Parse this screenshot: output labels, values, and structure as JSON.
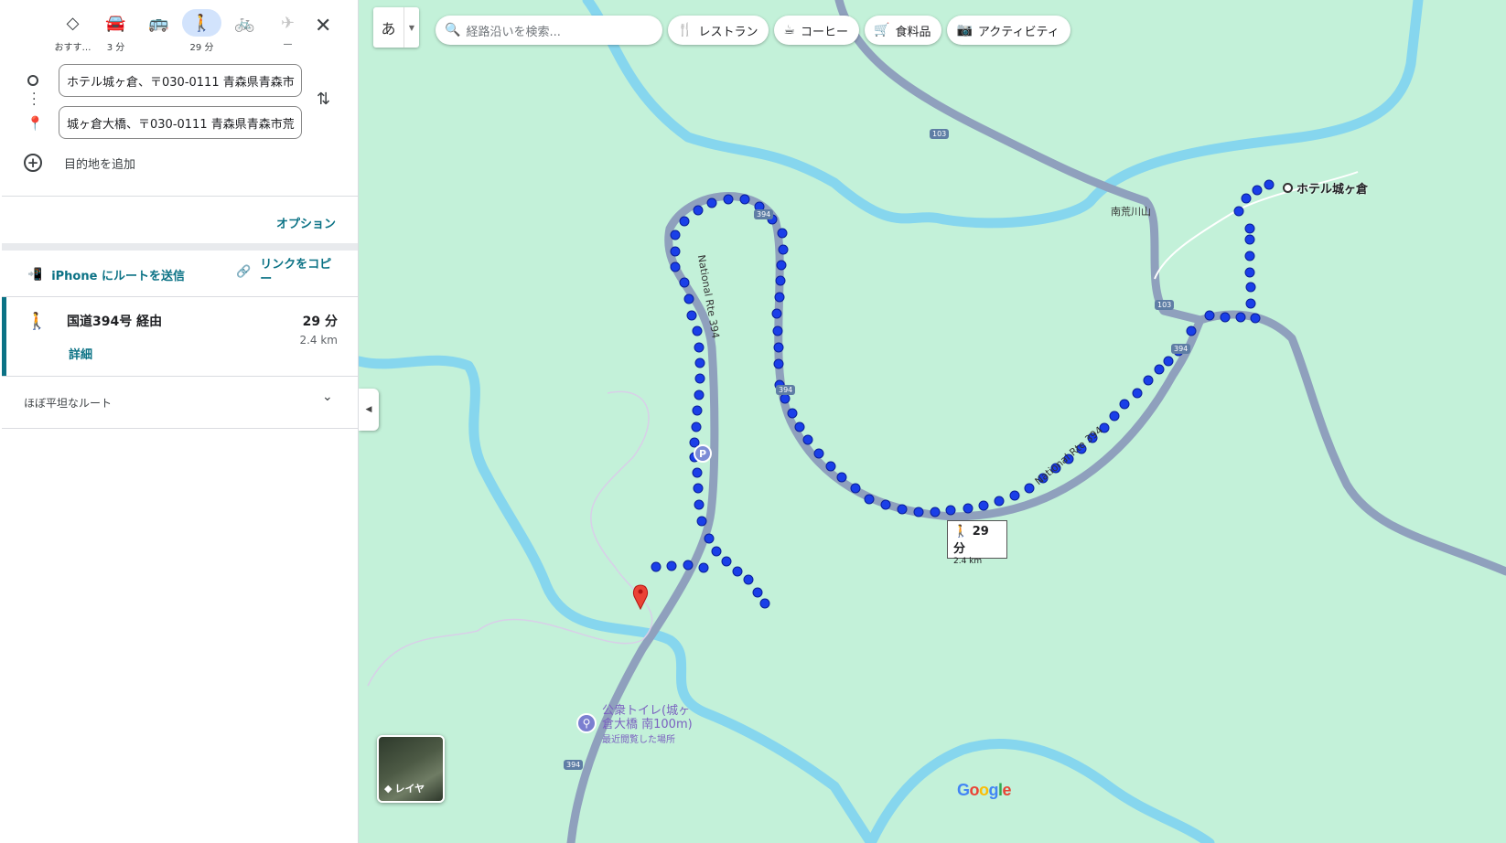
{
  "panel": {
    "modes": [
      {
        "name": "best",
        "icon": "diamond-route-icon",
        "glyph": "◇",
        "label": "おすす…"
      },
      {
        "name": "drive",
        "icon": "car-icon",
        "glyph": "🚘",
        "label": "3 分"
      },
      {
        "name": "transit",
        "icon": "bus-icon",
        "glyph": "🚌",
        "label": ""
      },
      {
        "name": "walk",
        "icon": "walking-icon",
        "glyph": "🚶",
        "label": "29 分"
      },
      {
        "name": "bike",
        "icon": "bicycle-icon",
        "glyph": "🚲",
        "label": ""
      },
      {
        "name": "flight",
        "icon": "airplane-icon",
        "glyph": "✈",
        "label": "—"
      }
    ],
    "origin_value": "ホテル城ヶ倉、〒030-0111 青森県青森市",
    "destination_value": "城ヶ倉大橋、〒030-0111 青森県青森市荒",
    "add_destination": "目的地を追加",
    "options": "オプション",
    "send_to_phone": "iPhone にルートを送信",
    "copy_link": "リンクをコピー",
    "route": {
      "via": "国道394号 経由",
      "details": "詳細",
      "duration": "29 分",
      "distance": "2.4 km"
    },
    "terrain_note": "ほぼ平坦なルート"
  },
  "map": {
    "ime_char": "あ",
    "search_placeholder": "経路沿いを検索...",
    "chips": [
      "レストラン",
      "コーヒー",
      "食料品",
      "アクティビティ"
    ],
    "time_label": {
      "duration": "29 分",
      "distance": "2.4 km"
    },
    "origin_label": "ホテル城ヶ倉",
    "place_minamiarakawa": "南荒川山",
    "road_labels": {
      "r394": "394",
      "r103": "103",
      "rte": "National Rte 394"
    },
    "poi": {
      "name": "公衆トイレ(城ヶ倉大橋 南100m)",
      "sub": "最近閲覧した場所"
    },
    "layers": "レイヤ",
    "brand": "Google",
    "colors": {
      "route_dot": "#1a3fe8",
      "river": "#7dd3ee",
      "terrain": "#c3f1d9",
      "road": "#8fa0bd",
      "accent": "#0b7285",
      "dest_pin": "#ea4335"
    }
  }
}
